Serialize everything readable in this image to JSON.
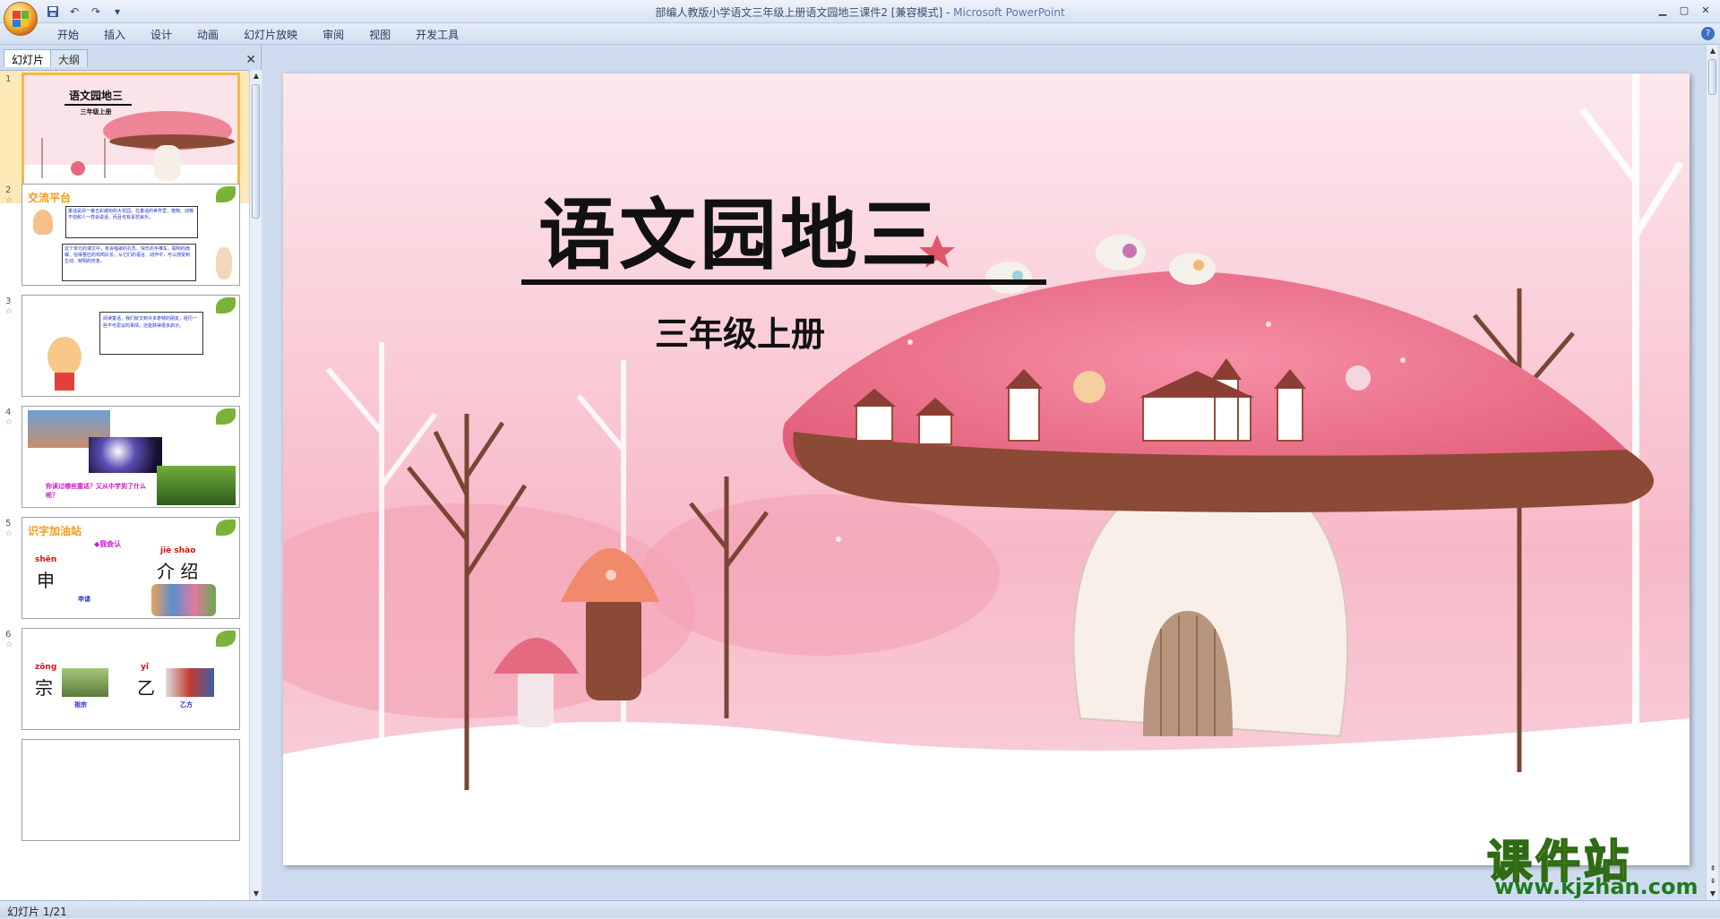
{
  "window": {
    "title": "部编人教版小学语文三年级上册语文园地三课件2 [兼容模式]",
    "app_name": "Microsoft PowerPoint"
  },
  "quick_access": {
    "save": "save-icon",
    "undo": "undo-icon",
    "redo": "redo-icon",
    "more": "▾"
  },
  "ribbon": {
    "tabs": [
      "开始",
      "插入",
      "设计",
      "动画",
      "幻灯片放映",
      "审阅",
      "视图",
      "开发工具"
    ]
  },
  "panel": {
    "tab_slides": "幻灯片",
    "tab_outline": "大纲",
    "close": "✕"
  },
  "thumbnails": [
    {
      "num": "1",
      "title": "语文园地三",
      "subtitle": "三年级上册"
    },
    {
      "num": "2",
      "heading": "交流平台",
      "bubble1": "童话是另一番五彩缤纷的大花园。在童话的世界里，植物、动物不但和人一样会说话，而且也有喜怒哀乐。",
      "bubble2": "这个单元的课文中，有会唱歌的孔乳、快乐的手推车、聪明的雨蝶、信得答应的鸡鸣队长。从它们的语言、动作中，可以感受到生动、鲜明的形象。"
    },
    {
      "num": "3",
      "bubble": "阅读童话，我们就交到许多奇特的朋友，经历一些不可思议的事情，还能获得很多启示。"
    },
    {
      "num": "4",
      "caption": "你读过哪些童话？又从中学到了什么呢？"
    },
    {
      "num": "5",
      "heading": "识字加油站",
      "tag": "◆我会认",
      "py1": "shēn",
      "c1": "申",
      "py2": "jiè shào",
      "c2": "介 绍",
      "word1": "申请"
    },
    {
      "num": "6",
      "py1": "zōng",
      "c1": "宗",
      "py2": "yǐ",
      "c2": "乙",
      "word1": "祖宗",
      "word2": "乙方"
    }
  ],
  "slide": {
    "title": "语文园地三",
    "subtitle": "三年级上册"
  },
  "status": {
    "slide_info": "幻灯片 1/21"
  },
  "watermark": {
    "brand": "课件站",
    "url": "www.kjzhan.com"
  },
  "colors": {
    "slide_bg": "#fbe6ec",
    "mushroom_cap": "#e8677e",
    "mushroom_brim": "#8b4a36",
    "selection": "#f7b64d"
  }
}
